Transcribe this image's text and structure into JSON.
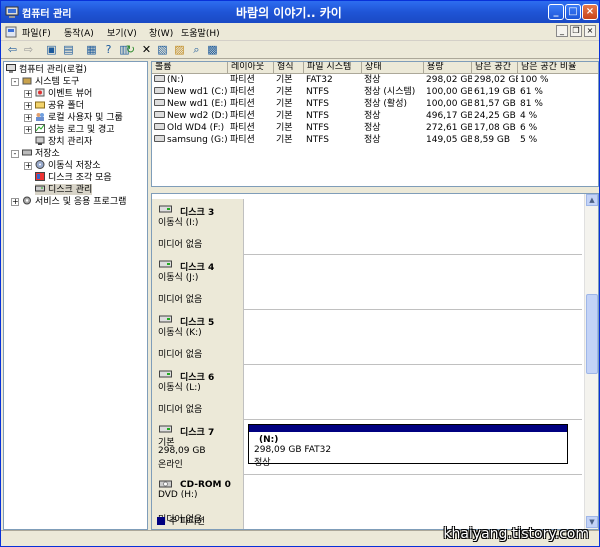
{
  "window": {
    "app_title": "컴퓨터 관리",
    "center_title": "바람의 이야기.. 카이"
  },
  "menu": [
    "파일(F)",
    "동작(A)",
    "보기(V)",
    "창(W)",
    "도움말(H)"
  ],
  "tree": [
    {
      "label": "컴퓨터 관리(로컬)",
      "level": 0,
      "icon": "computer-icon",
      "expander": ""
    },
    {
      "label": "시스템 도구",
      "level": 1,
      "icon": "tools-icon",
      "expander": "-"
    },
    {
      "label": "이벤트 뷰어",
      "level": 2,
      "icon": "event-viewer-icon",
      "expander": "+"
    },
    {
      "label": "공유 폴더",
      "level": 2,
      "icon": "shared-folder-icon",
      "expander": "+"
    },
    {
      "label": "로컬 사용자 및 그룹",
      "level": 2,
      "icon": "users-icon",
      "expander": "+"
    },
    {
      "label": "성능 로그 및 경고",
      "level": 2,
      "icon": "performance-icon",
      "expander": "+"
    },
    {
      "label": "장치 관리자",
      "level": 2,
      "icon": "device-manager-icon",
      "expander": ""
    },
    {
      "label": "저장소",
      "level": 1,
      "icon": "storage-icon",
      "expander": "-"
    },
    {
      "label": "이동식 저장소",
      "level": 2,
      "icon": "removable-storage-icon",
      "expander": "+"
    },
    {
      "label": "디스크 조각 모음",
      "level": 2,
      "icon": "defrag-icon",
      "expander": ""
    },
    {
      "label": "디스크 관리",
      "level": 2,
      "icon": "disk-management-icon",
      "expander": "",
      "selected": true
    },
    {
      "label": "서비스 및 응용 프로그램",
      "level": 1,
      "icon": "services-icon",
      "expander": "+"
    }
  ],
  "volume_list": {
    "columns": [
      "볼륨",
      "레이아웃",
      "형식",
      "파일 시스템",
      "상태",
      "용량",
      "남은 공간",
      "남은 공간 비율"
    ],
    "rows": [
      [
        "(N:)",
        "파티션",
        "기본",
        "FAT32",
        "정상",
        "298,02 GB",
        "298,02 GB",
        "100 %"
      ],
      [
        "New wd1 (C:)",
        "파티션",
        "기본",
        "NTFS",
        "정상 (시스템)",
        "100,00 GB",
        "61,19 GB",
        "61 %"
      ],
      [
        "New wd1 (E:)",
        "파티션",
        "기본",
        "NTFS",
        "정상 (활성)",
        "100,00 GB",
        "81,57 GB",
        "81 %"
      ],
      [
        "New wd2 (D:)",
        "파티션",
        "기본",
        "NTFS",
        "정상",
        "496,17 GB",
        "24,25 GB",
        "4 %"
      ],
      [
        "Old WD4 (F:)",
        "파티션",
        "기본",
        "NTFS",
        "정상",
        "272,61 GB",
        "17,08 GB",
        "6 %"
      ],
      [
        "samsung (G:)",
        "파티션",
        "기본",
        "NTFS",
        "정상",
        "149,05 GB",
        "8,59 GB",
        "5 %"
      ]
    ]
  },
  "disks": [
    {
      "title": "디스크 3",
      "line1": "이동식 (I:)",
      "line2": "",
      "line3": "미디어 없음",
      "icon": "removable-disk-icon"
    },
    {
      "title": "디스크 4",
      "line1": "이동식 (J:)",
      "line2": "",
      "line3": "미디어 없음",
      "icon": "removable-disk-icon"
    },
    {
      "title": "디스크 5",
      "line1": "이동식 (K:)",
      "line2": "",
      "line3": "미디어 없음",
      "icon": "removable-disk-icon"
    },
    {
      "title": "디스크 6",
      "line1": "이동식 (L:)",
      "line2": "",
      "line3": "미디어 없음",
      "icon": "removable-disk-icon"
    },
    {
      "title": "디스크 7",
      "line1": "기본",
      "line2": "298,09 GB",
      "line3": "온라인",
      "icon": "hard-disk-icon",
      "volume": {
        "name": "(N:)",
        "size": "298,09 GB FAT32",
        "status": "정상"
      }
    },
    {
      "title": "CD-ROM 0",
      "line1": "DVD (H:)",
      "line2": "",
      "line3": "미디어 없음",
      "icon": "cdrom-icon"
    }
  ],
  "legend": {
    "label": "주 파티션",
    "color": "#000080"
  },
  "watermark": "khaiyang.tistory.com"
}
